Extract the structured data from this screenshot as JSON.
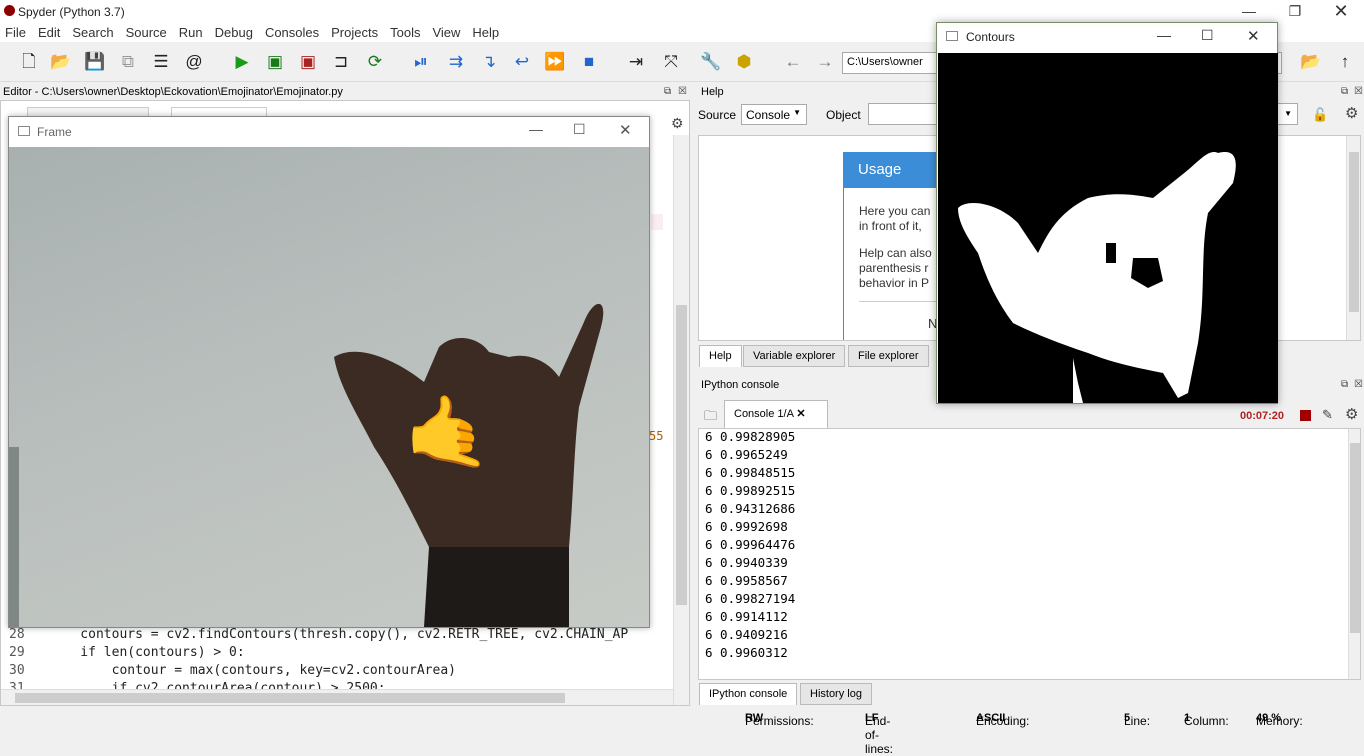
{
  "app": {
    "title": "Spyder (Python 3.7)"
  },
  "menu": [
    "File",
    "Edit",
    "Search",
    "Source",
    "Run",
    "Debug",
    "Consoles",
    "Projects",
    "Tools",
    "View",
    "Help"
  ],
  "toolbar": {
    "path": "C:\\Users\\owner"
  },
  "editor": {
    "title": "Editor - C:\\Users\\owner\\Desktop\\Eckovation\\Emojinator\\Emojinator.py",
    "lines": [
      {
        "num": "28",
        "code": "    contours = cv2.findContours(thresh.copy(), cv2.RETR_TREE, cv2.CHAIN_AP"
      },
      {
        "num": "29",
        "code": "    if len(contours) > 0:"
      },
      {
        "num": "30",
        "code": "        contour = max(contours, key=cv2.contourArea)"
      },
      {
        "num": "31",
        "code": "        if cv2.contourArea(contour) > 2500:"
      }
    ],
    "peek_text": "55"
  },
  "frame_window": {
    "title": "Frame"
  },
  "help": {
    "title": "Help",
    "source_label": "Source",
    "source_value": "Console",
    "object_label": "Object",
    "usage_title": "Usage",
    "usage_p1a": "Here you can",
    "usage_p1b": "in front of it,",
    "usage_p2a": "Help can also",
    "usage_p2b": "parenthesis r",
    "usage_p2c": "behavior in P",
    "usage_n": "N"
  },
  "help_tabs": [
    "Help",
    "Variable explorer",
    "File explorer"
  ],
  "ipython": {
    "title": "IPython console",
    "tab": "Console 1/A",
    "timer": "00:07:20",
    "lines": [
      "6 0.99828905",
      "6 0.9965249",
      "6 0.99848515",
      "6 0.99892515",
      "6 0.94312686",
      "6 0.9992698",
      "6 0.99964476",
      "6 0.9940339",
      "6 0.9958567",
      "6 0.99827194",
      "6 0.9914112",
      "6 0.9409216",
      "6 0.9960312"
    ]
  },
  "bottom_tabs": [
    "IPython console",
    "History log"
  ],
  "contours_window": {
    "title": "Contours"
  },
  "status": {
    "permissions_label": "Permissions:",
    "permissions": "RW",
    "eol_label": "End-of-lines:",
    "eol": "LF",
    "encoding_label": "Encoding:",
    "encoding": "ASCII",
    "line_label": "Line:",
    "line": "5",
    "column_label": "Column:",
    "column": "1",
    "memory_label": "Memory:",
    "memory": "49 %"
  },
  "colors": {
    "accent": "#3c8dd8",
    "run": "#1a9a1a",
    "timer": "#b22222"
  }
}
